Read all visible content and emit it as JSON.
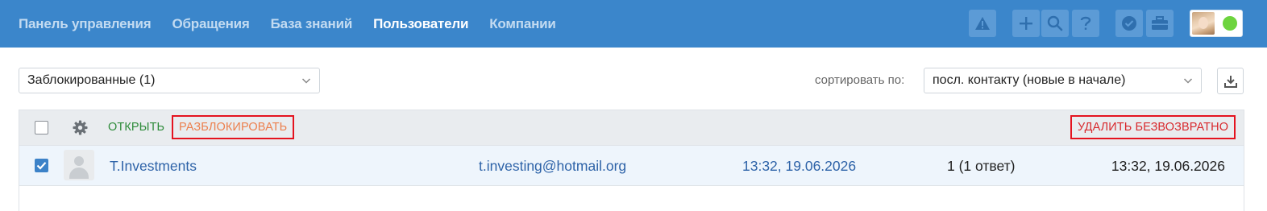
{
  "nav": {
    "items": [
      {
        "label": "Панель управления",
        "active": false
      },
      {
        "label": "Обращения",
        "active": false
      },
      {
        "label": "База знаний",
        "active": false
      },
      {
        "label": "Пользователи",
        "active": true
      },
      {
        "label": "Компании",
        "active": false
      }
    ]
  },
  "toolbar_icons": [
    "warning-icon",
    "plus-icon",
    "search-icon",
    "help-icon",
    "verified-badge-icon",
    "briefcase-icon"
  ],
  "colors": {
    "header_bg": "#3b86cb",
    "status_online": "#6dd43e",
    "open_action": "#2e8b3a",
    "unblock_action": "#ec7f4d",
    "delete_action": "#d8282c",
    "link": "#2e63a8"
  },
  "filter": {
    "selected": "Заблокированные (1)"
  },
  "sort": {
    "label": "сортировать по:",
    "selected": "посл. контакту (новые в начале)"
  },
  "bulk_actions": {
    "open": "ОТКРЫТЬ",
    "unblock": "РАЗБЛОКИРОВАТЬ",
    "delete": "УДАЛИТЬ БЕЗВОЗВРАТНО"
  },
  "users": [
    {
      "checked": true,
      "name": "T.Investments",
      "email": "t.investing@hotmail.org",
      "created": "13:32, 19.06.2026",
      "requests": "1 (1 ответ)",
      "last_contact": "13:32, 19.06.2026"
    }
  ]
}
